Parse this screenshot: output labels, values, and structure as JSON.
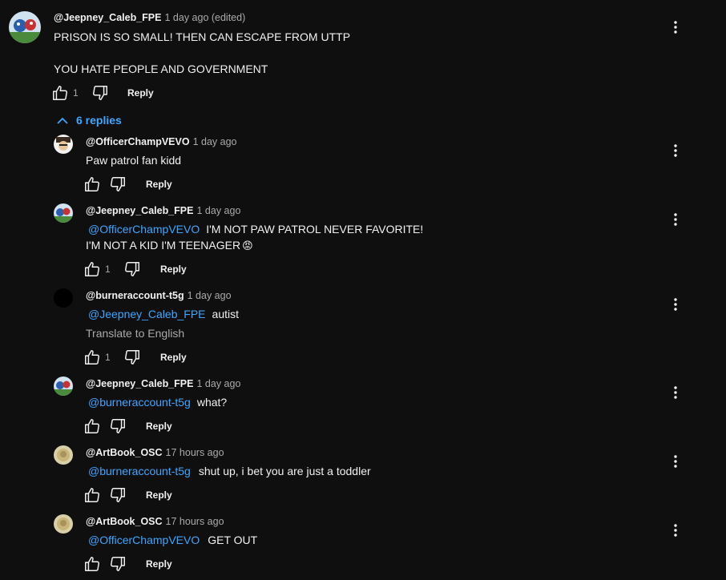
{
  "colors": {
    "background": "#0f0f0f",
    "text": "#f1f1f1",
    "secondary": "#aaaaaa",
    "link": "#3ea6ff"
  },
  "top_comment": {
    "author": "@Jeepney_Caleb_FPE",
    "time": "1 day ago (edited)",
    "line1": "PRISON IS SO SMALL! THEN CAN ESCAPE FROM UTTP",
    "line2": "YOU HATE PEOPLE AND GOVERNMENT",
    "likes": "1",
    "reply_label": "Reply"
  },
  "replies_toggle": {
    "label": "6 replies",
    "icon": "chevron-up-icon"
  },
  "replies": [
    {
      "author": "@OfficerChampVEVO",
      "time": "1 day ago",
      "mention": "",
      "text": "Paw patrol fan kidd",
      "likes": "",
      "reply_label": "Reply"
    },
    {
      "author": "@Jeepney_Caleb_FPE",
      "time": "1 day ago",
      "mention": "@OfficerChampVEVO",
      "text": "I'M NOT PAW PATROL NEVER FAVORITE!",
      "text2": "I'M NOT A KID I'M TEENAGER",
      "emoji": "😡",
      "likes": "1",
      "reply_label": "Reply"
    },
    {
      "author": "@burneraccount-t5g",
      "time": "1 day ago",
      "mention": "@Jeepney_Caleb_FPE",
      "text": "autist",
      "translate": "Translate to English",
      "likes": "1",
      "reply_label": "Reply"
    },
    {
      "author": "@Jeepney_Caleb_FPE",
      "time": "1 day ago",
      "mention": "@burneraccount-t5g",
      "text": "what?",
      "likes": "",
      "reply_label": "Reply"
    },
    {
      "author": "@ArtBook_OSC",
      "time": "17 hours ago",
      "mention": "@burneraccount-t5g",
      "text": "shut up, i bet you are just a toddler",
      "likes": "",
      "reply_label": "Reply"
    },
    {
      "author": "@ArtBook_OSC",
      "time": "17 hours ago",
      "mention": "@OfficerChampVEVO",
      "text": "GET OUT",
      "likes": "",
      "reply_label": "Reply"
    }
  ]
}
